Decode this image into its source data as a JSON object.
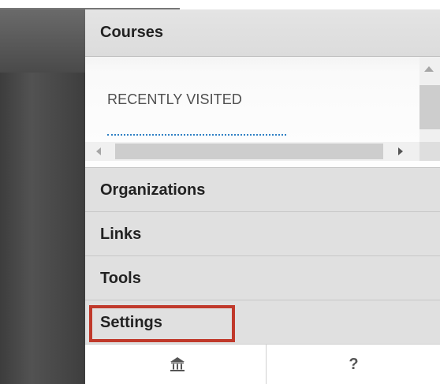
{
  "nav": {
    "courses": "Courses",
    "recently_visited": "RECENTLY VISITED",
    "organizations": "Organizations",
    "links": "Links",
    "tools": "Tools",
    "settings": "Settings"
  },
  "footer": {
    "home_icon": "home-icon",
    "help_label": "?"
  },
  "colors": {
    "highlight": "#c0392b",
    "section_bg": "#e0e0e0",
    "dark_bar": "#474747",
    "link_underline": "#2f80c4"
  }
}
